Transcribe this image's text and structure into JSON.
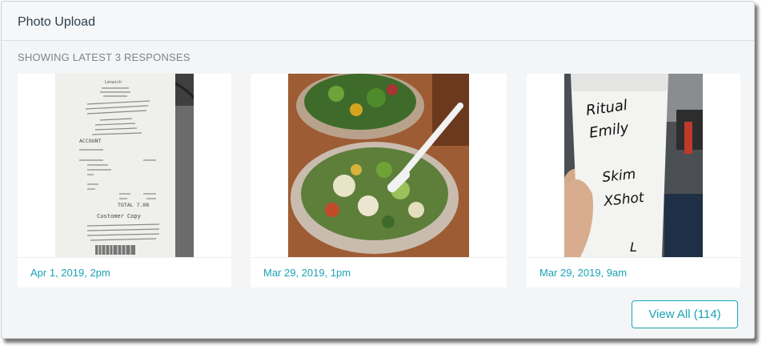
{
  "header": {
    "title": "Photo Upload"
  },
  "subtitle": "SHOWING LATEST 3 RESPONSES",
  "responses": [
    {
      "date": "Apr 1, 2019, 2pm",
      "image": "photo of store receipt"
    },
    {
      "date": "Mar 29, 2019, 1pm",
      "image": "photo of salad bowls"
    },
    {
      "date": "Mar 29, 2019, 9am",
      "image": "photo of coffee cup with handwriting"
    }
  ],
  "receipt": {
    "lines": [
      "Lenwich",
      "ACCOUNT",
      "Customer Copy",
      "TOTAL 7.08"
    ]
  },
  "cup": {
    "handwriting": [
      "Ritual",
      "Emily",
      "Skim",
      "XShot",
      "L"
    ]
  },
  "view_all": {
    "label": "View All (114)"
  },
  "colors": {
    "accent": "#1aa3b5",
    "title": "#2c3e50",
    "muted": "#7d858d"
  }
}
